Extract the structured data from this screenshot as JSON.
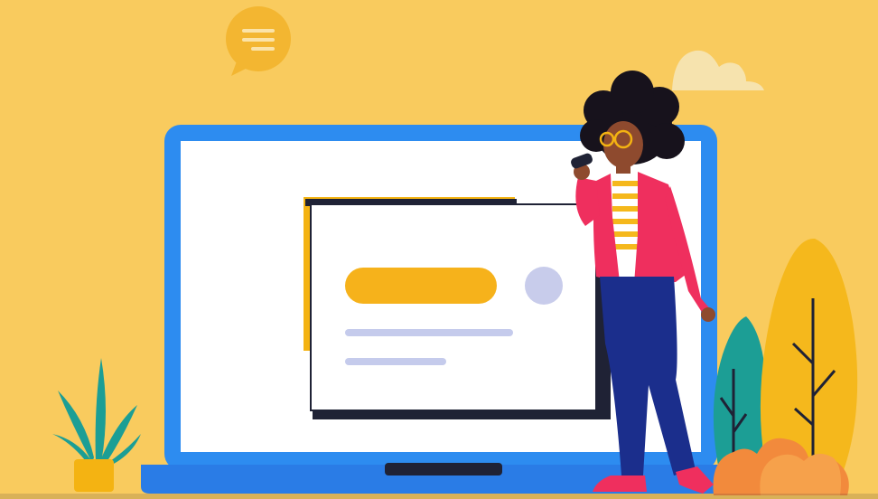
{
  "scene": {
    "icons": [
      "chat-bubble-icon",
      "cloud-icon",
      "laptop-icon",
      "potted-plant-icon",
      "tree-icon",
      "bush-icon",
      "microphone-icon"
    ],
    "colors": {
      "background": "#F9CB5E",
      "laptop_frame": "#2D8CF0",
      "laptop_base": "#2A7CE6",
      "screen": "#FFFFFF",
      "card_shadow": "#1F2235",
      "card_back": "#F4B312",
      "pill_button": "#F6B21B",
      "avatar_circle": "#C8CCEB",
      "text_lines": "#C5CBEC",
      "jacket": "#EF2F5E",
      "pants": "#1B2E8C",
      "skin": "#8E4A2E",
      "hair": "#17121C",
      "tree_yellow": "#F5B81C",
      "tree_teal": "#1C9E95",
      "bush_orange": "#F28A3C",
      "plant_leaves": "#1C9E95",
      "pot": "#F4B312",
      "cloud": "#F6E3AE",
      "bubble": "#F3B631"
    }
  }
}
